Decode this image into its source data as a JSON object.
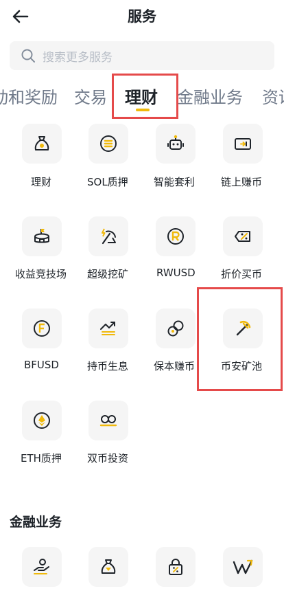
{
  "header": {
    "title": "服务",
    "back_icon": "arrow-left-icon"
  },
  "search": {
    "placeholder": "搜索更多服务",
    "icon": "search-icon"
  },
  "tabs": [
    {
      "label": "动和奖励"
    },
    {
      "label": "交易"
    },
    {
      "label": "理财",
      "active": true
    },
    {
      "label": "金融业务"
    },
    {
      "label": "资讯"
    }
  ],
  "accent_color": "#f0b90b",
  "highlight_color": "#e54a4a",
  "items": [
    {
      "label": "理财",
      "icon": "money-bag-icon"
    },
    {
      "label": "SOL质押",
      "icon": "sol-coin-icon"
    },
    {
      "label": "智能套利",
      "icon": "robot-icon"
    },
    {
      "label": "链上赚币",
      "icon": "onchain-card-icon"
    },
    {
      "label": "收益竞技场",
      "icon": "arena-icon"
    },
    {
      "label": "超级挖矿",
      "icon": "super-mining-icon"
    },
    {
      "label": "RWUSD",
      "icon": "rwusd-coin-icon"
    },
    {
      "label": "折价买币",
      "icon": "discount-tag-icon"
    },
    {
      "label": "BFUSD",
      "icon": "bfusd-coin-icon"
    },
    {
      "label": "持币生息",
      "icon": "growth-chart-icon"
    },
    {
      "label": "保本赚币",
      "icon": "principal-protected-icon"
    },
    {
      "label": "币安矿池",
      "icon": "pickaxe-icon"
    },
    {
      "label": "ETH质押",
      "icon": "eth-coin-icon"
    },
    {
      "label": "双币投资",
      "icon": "dual-coin-icon"
    }
  ],
  "section2": {
    "title": "金融业务",
    "icons": [
      "hand-coin-icon",
      "diamond-bag-icon",
      "lock-percent-icon",
      "w-logo-icon"
    ]
  }
}
